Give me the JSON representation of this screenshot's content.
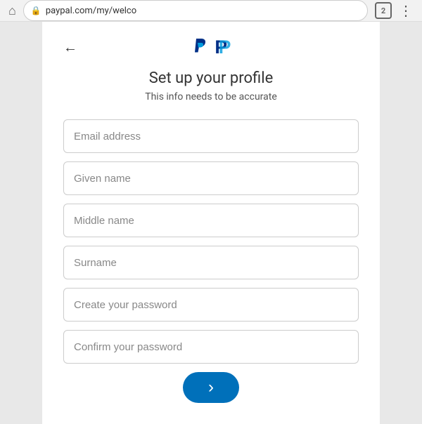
{
  "browser": {
    "home_label": "🏠",
    "address": "paypal.com/my/welco",
    "lock_icon": "🔒",
    "tab_number": "2",
    "menu_dots": "⋮"
  },
  "page": {
    "back_arrow": "←",
    "title": "Set up your profile",
    "subtitle": "This info needs to be accurate"
  },
  "form": {
    "email_placeholder": "Email address",
    "given_name_placeholder": "Given name",
    "middle_name_placeholder": "Middle name",
    "surname_placeholder": "Surname",
    "create_password_placeholder": "Create your password",
    "confirm_password_placeholder": "Confirm your password",
    "submit_arrow": "›"
  }
}
